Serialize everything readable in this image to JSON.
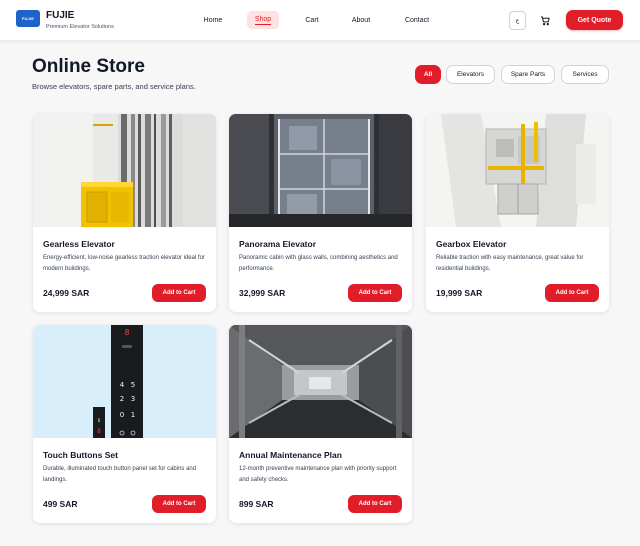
{
  "header": {
    "logo_text": "FUJIE",
    "brand_name": "FUJIE",
    "brand_tagline": "Premium Elevator Solutions",
    "nav": [
      {
        "label": "Home"
      },
      {
        "label": "Shop",
        "active": true
      },
      {
        "label": "Cart"
      },
      {
        "label": "About"
      },
      {
        "label": "Contact"
      }
    ],
    "lang_label": "ع",
    "cta_label": "Get Quote"
  },
  "page": {
    "title": "Online Store",
    "subtitle": "Browse elevators, spare parts, and service plans."
  },
  "filters": [
    {
      "label": "All",
      "active": true
    },
    {
      "label": "Elevators"
    },
    {
      "label": "Spare Parts"
    },
    {
      "label": "Services"
    }
  ],
  "products": [
    {
      "name": "Gearless Elevator",
      "description": "Energy-efficient, low-noise gearless traction elevator ideal for modern buildings.",
      "price": "24,999 SAR",
      "button": "Add to Cart",
      "image": "yellow-cabin-shaft"
    },
    {
      "name": "Panorama Elevator",
      "description": "Panoramic cabin with glass walls, combining aesthetics and performance.",
      "price": "32,999 SAR",
      "button": "Add to Cart",
      "image": "glass-cabin"
    },
    {
      "name": "Gearbox Elevator",
      "description": "Reliable traction with easy maintenance, great value for residential buildings.",
      "price": "19,999 SAR",
      "button": "Add to Cart",
      "image": "shaft-machinery"
    },
    {
      "name": "Touch Buttons Set",
      "description": "Durable, illuminated touch button panel set for cabins and landings.",
      "price": "499 SAR",
      "button": "Add to Cart",
      "image": "button-panel"
    },
    {
      "name": "Annual Maintenance Plan",
      "description": "12-month preventive maintenance plan with priority support and safety checks.",
      "price": "899 SAR",
      "button": "Add to Cart",
      "image": "shaft-view-up"
    }
  ],
  "panel_display": {
    "floor_digit": "8",
    "buttons": [
      "4",
      "5",
      "2",
      "3",
      "0",
      "1"
    ],
    "small_display": "8"
  },
  "colors": {
    "accent": "#e11d2a",
    "logo_blue": "#1e63c8",
    "background": "#f7f7f8"
  }
}
